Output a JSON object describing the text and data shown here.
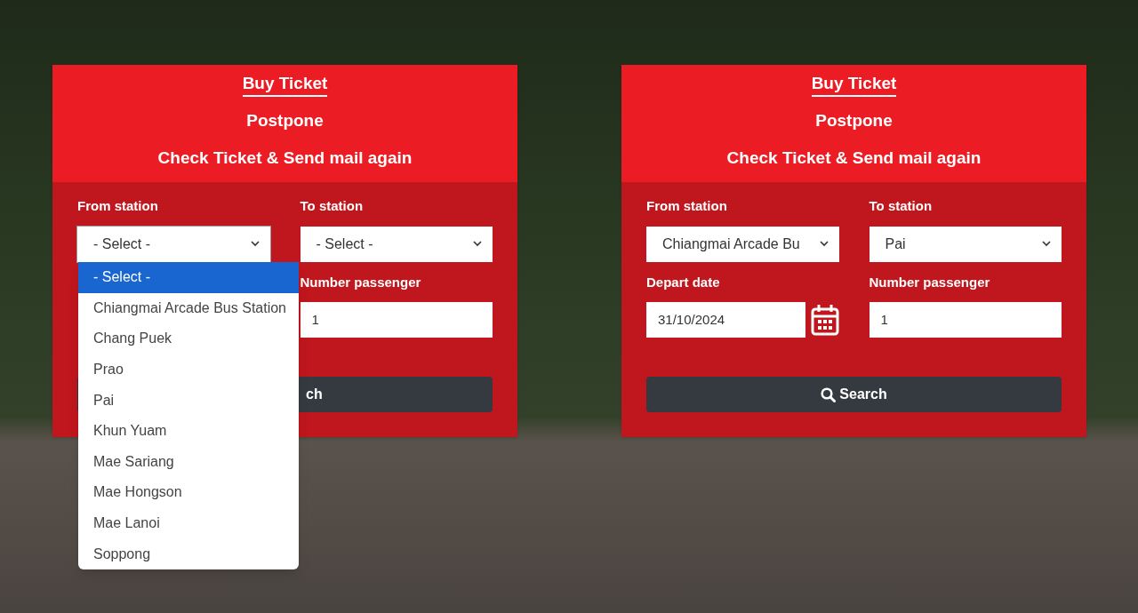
{
  "screens": [
    {
      "tabs": [
        {
          "label": "Buy Ticket",
          "selected": true
        },
        {
          "label": "Postpone",
          "selected": false
        },
        {
          "label": "Check Ticket & Send mail again",
          "selected": false
        }
      ],
      "from_station": {
        "label": "From station",
        "value": "- Select -",
        "open": true,
        "options": [
          {
            "label": "- Select -",
            "selected": true
          },
          {
            "label": "Chiangmai Arcade Bus Station",
            "selected": false
          },
          {
            "label": "Chang Puek",
            "selected": false
          },
          {
            "label": "Prao",
            "selected": false
          },
          {
            "label": "Pai",
            "selected": false
          },
          {
            "label": "Khun Yuam",
            "selected": false
          },
          {
            "label": "Mae Sariang",
            "selected": false
          },
          {
            "label": "Mae Hongson",
            "selected": false
          },
          {
            "label": "Mae Lanoi",
            "selected": false
          },
          {
            "label": "Soppong",
            "selected": false
          }
        ]
      },
      "to_station": {
        "label": "To station",
        "value": "- Select -"
      },
      "passenger": {
        "label": "Number passenger",
        "value": "1"
      },
      "search_button": {
        "label": "ch",
        "icon": false
      }
    },
    {
      "tabs": [
        {
          "label": "Buy Ticket",
          "selected": true
        },
        {
          "label": "Postpone",
          "selected": false
        },
        {
          "label": "Check Ticket & Send mail again",
          "selected": false
        }
      ],
      "from_station": {
        "label": "From station",
        "value": "Chiangmai Arcade Bu",
        "open": false
      },
      "to_station": {
        "label": "To station",
        "value": "Pai"
      },
      "depart_date": {
        "label": "Depart date",
        "value": "31/10/2024"
      },
      "passenger": {
        "label": "Number passenger",
        "value": "1"
      },
      "search_button": {
        "label": "Search",
        "icon": true
      }
    }
  ]
}
